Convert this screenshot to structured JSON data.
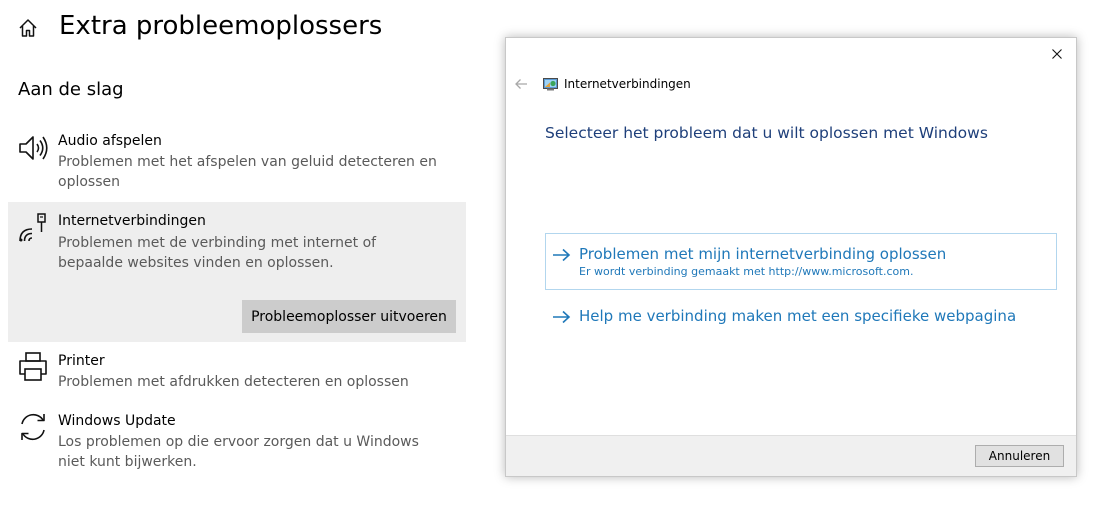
{
  "page": {
    "title": "Extra probleemoplossers",
    "section_title": "Aan de slag"
  },
  "troubleshooters": [
    {
      "name": "Audio afspelen",
      "description": "Problemen met het afspelen van geluid detecteren en oplossen",
      "icon": "speaker-icon"
    },
    {
      "name": "Internetverbindingen",
      "description": "Problemen met de verbinding met internet of bepaalde websites vinden en oplossen.",
      "icon": "network-icon",
      "selected": true,
      "run_label": "Probleemoplosser uitvoeren"
    },
    {
      "name": "Printer",
      "description": "Problemen met afdrukken detecteren en oplossen",
      "icon": "printer-icon"
    },
    {
      "name": "Windows Update",
      "description": "Los problemen op die ervoor zorgen dat u Windows niet kunt bijwerken.",
      "icon": "update-icon"
    }
  ],
  "dialog": {
    "app_title": "Internetverbindingen",
    "heading": "Selecteer het probleem dat u wilt oplossen met Windows",
    "options": [
      {
        "title": "Problemen met mijn internetverbinding oplossen",
        "subtitle": "Er wordt verbinding gemaakt met http://www.microsoft.com.",
        "focused": true
      },
      {
        "title": "Help me verbinding maken met een specifieke webpagina"
      }
    ],
    "cancel_label": "Annuleren"
  },
  "colors": {
    "link_blue": "#1f78b9",
    "heading_blue": "#1e3f7a",
    "selected_bg": "#eeeeee",
    "button_bg": "#cccccc"
  }
}
